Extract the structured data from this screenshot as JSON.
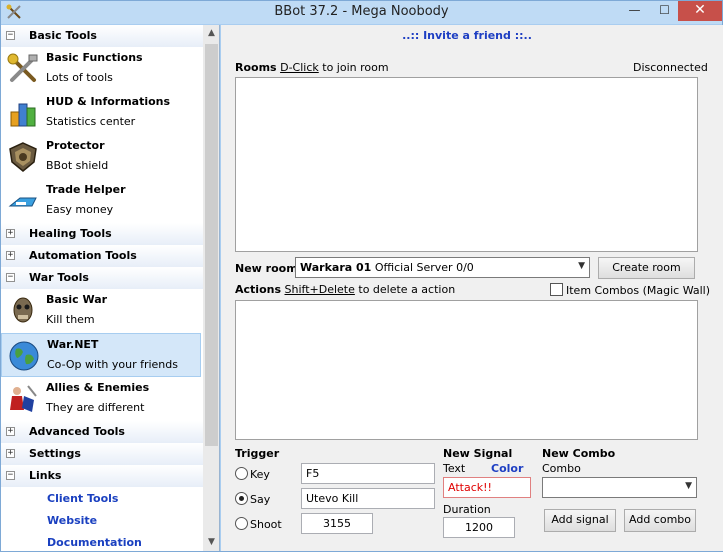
{
  "window": {
    "title": "BBot 37.2 - Mega Noobody",
    "min": "—",
    "max": "☐",
    "close": "✕"
  },
  "sidebar": {
    "groups": {
      "basic_tools": {
        "toggle": "−",
        "label": "Basic Tools"
      },
      "healing_tools": {
        "toggle": "+",
        "label": "Healing Tools"
      },
      "automation_tools": {
        "toggle": "+",
        "label": "Automation Tools"
      },
      "war_tools": {
        "toggle": "−",
        "label": "War Tools"
      },
      "advanced_tools": {
        "toggle": "+",
        "label": "Advanced Tools"
      },
      "settings": {
        "toggle": "+",
        "label": "Settings"
      },
      "links": {
        "toggle": "−",
        "label": "Links"
      }
    },
    "items": {
      "basic_functions": {
        "title": "Basic Functions",
        "subtitle": "Lots of tools",
        "icon": "tools-icon"
      },
      "hud": {
        "title": "HUD & Informations",
        "subtitle": "Statistics center",
        "icon": "chart-icon"
      },
      "protector": {
        "title": "Protector",
        "subtitle": "BBot shield",
        "icon": "shield-icon"
      },
      "trade_helper": {
        "title": "Trade Helper",
        "subtitle": "Easy money",
        "icon": "trade-icon"
      },
      "basic_war": {
        "title": "Basic War",
        "subtitle": "Kill them",
        "icon": "skull-icon"
      },
      "war_net": {
        "title": "War.NET",
        "subtitle": "Co-Op with your friends",
        "icon": "globe-icon"
      },
      "allies": {
        "title": "Allies & Enemies",
        "subtitle": "They are different",
        "icon": "fighter-icon"
      }
    },
    "links": {
      "client_tools": "Client Tools",
      "website": "Website",
      "documentation": "Documentation"
    },
    "scroll_up": "▲",
    "scroll_down": "▼"
  },
  "main": {
    "invite": "..:: Invite a friend ::..",
    "rooms": {
      "label": "Rooms",
      "hint_key": "D-Click",
      "hint_rest": "to join room",
      "status": "Disconnected"
    },
    "new_room": {
      "label": "New room",
      "server_name": "Warkara 01",
      "server_rest": "Official Server 0/0",
      "arrow": "▼",
      "create_button": "Create room"
    },
    "actions": {
      "label": "Actions",
      "hint_key": "Shift+Delete",
      "hint_rest": "to delete a action",
      "item_combos": "Item Combos (Magic Wall)",
      "item_combos_checked": false
    },
    "trigger": {
      "title": "Trigger",
      "key_label": "Key",
      "key_value": "F5",
      "say_label": "Say",
      "say_value": "Utevo Kill",
      "shoot_label": "Shoot",
      "shoot_value": "3155",
      "selected": "say"
    },
    "signal": {
      "title": "New Signal",
      "text_label": "Text",
      "color_label": "Color",
      "text_value": "Attack!!",
      "text_color": "#e00000",
      "duration_label": "Duration",
      "duration_value": "1200",
      "add_button": "Add signal"
    },
    "combo": {
      "title": "New Combo",
      "combo_label": "Combo",
      "combo_value": "",
      "arrow": "▼",
      "add_button": "Add combo"
    }
  }
}
